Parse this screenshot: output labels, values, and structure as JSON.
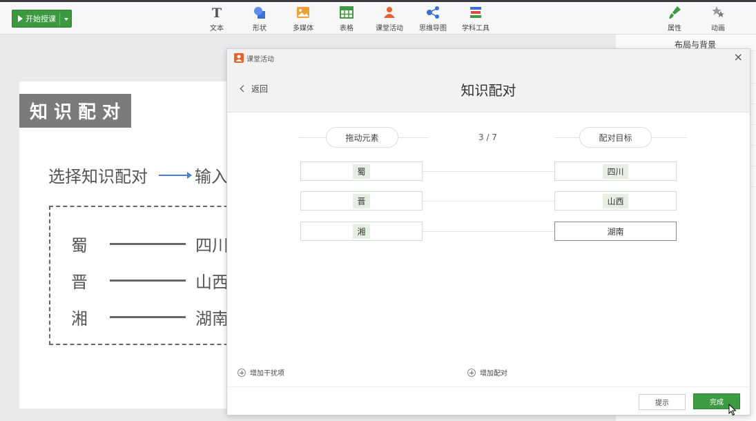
{
  "toolbar": {
    "start_label": "开始授课",
    "tools": [
      {
        "label": "文本",
        "icon": "text-icon"
      },
      {
        "label": "形状",
        "icon": "shape-icon"
      },
      {
        "label": "多媒体",
        "icon": "media-icon"
      },
      {
        "label": "表格",
        "icon": "table-icon"
      },
      {
        "label": "课堂活动",
        "icon": "class-activity-icon"
      },
      {
        "label": "思维导图",
        "icon": "mindmap-icon"
      },
      {
        "label": "学科工具",
        "icon": "subject-tools-icon"
      }
    ],
    "right_tabs": [
      {
        "label": "属性",
        "icon": "brush-icon"
      },
      {
        "label": "动画",
        "icon": "star-icon"
      }
    ]
  },
  "right_panel": {
    "title": "布局与背景"
  },
  "slide": {
    "title": "知识配对",
    "flow_start": "选择知识配对",
    "flow_end": "输入",
    "rows": [
      {
        "left": "蜀",
        "right": "四川"
      },
      {
        "left": "晋",
        "right": "山西"
      },
      {
        "left": "湘",
        "right": "湖南"
      }
    ]
  },
  "dialog": {
    "name": "课堂活动",
    "back_label": "返回",
    "title": "知识配对",
    "left_header": "拖动元素",
    "right_header": "配对目标",
    "counter": "3 / 7",
    "pairs": [
      {
        "left": "蜀",
        "right": "四川"
      },
      {
        "left": "晋",
        "right": "山西"
      },
      {
        "left": "湘",
        "right": "湖南"
      }
    ],
    "add_distractor": "增加干扰项",
    "add_pair": "增加配对",
    "hint_button": "提示",
    "done_button": "完成"
  },
  "colors": {
    "accent": "#3d9c43",
    "header_bg": "#f2f2f2",
    "chip_bg": "#e7efe4"
  }
}
